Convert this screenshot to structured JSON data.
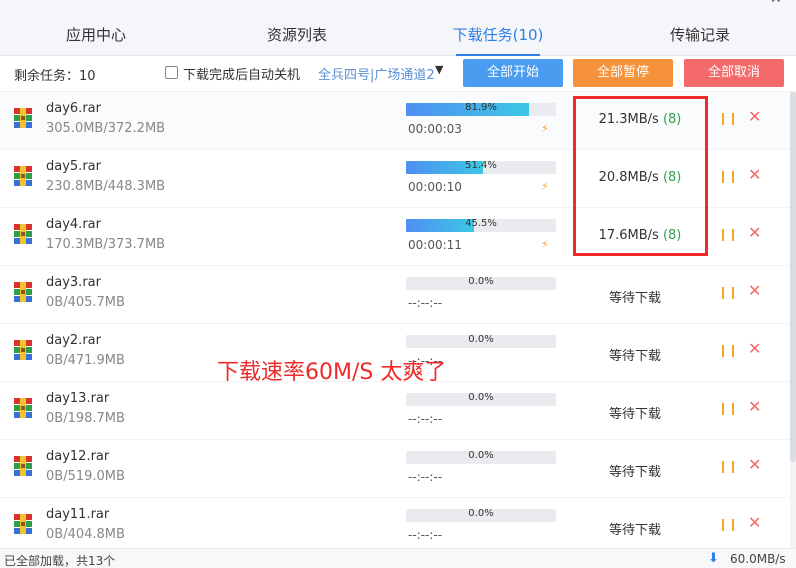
{
  "tabs": [
    {
      "label": "应用中心",
      "active": false
    },
    {
      "label": "资源列表",
      "active": false
    },
    {
      "label": "下载任务(10)",
      "active": true
    },
    {
      "label": "传输记录",
      "active": false
    }
  ],
  "toolbar": {
    "remaining": "剩余任务：10",
    "auto_shutdown_label": "下载完成后自动关机",
    "auto_shutdown_checked": false,
    "channel": "全兵四号|广场通道2",
    "start_all": "全部开始",
    "pause_all": "全部暂停",
    "cancel_all": "全部取消"
  },
  "tasks": [
    {
      "name": "day6.rar",
      "size": "305.0MB/372.2MB",
      "progress": 81.9,
      "progress_label": "81.9%",
      "elapsed": "00:00:03",
      "speed": "21.3MB/s",
      "connections": "(8)",
      "status": "downloading"
    },
    {
      "name": "day5.rar",
      "size": "230.8MB/448.3MB",
      "progress": 51.4,
      "progress_label": "51.4%",
      "elapsed": "00:00:10",
      "speed": "20.8MB/s",
      "connections": "(8)",
      "status": "downloading"
    },
    {
      "name": "day4.rar",
      "size": "170.3MB/373.7MB",
      "progress": 45.5,
      "progress_label": "45.5%",
      "elapsed": "00:00:11",
      "speed": "17.6MB/s",
      "connections": "(8)",
      "status": "downloading"
    },
    {
      "name": "day3.rar",
      "size": "0B/405.7MB",
      "progress": 0,
      "progress_label": "0.0%",
      "elapsed": "--:--:--",
      "wait_label": "等待下载",
      "status": "waiting"
    },
    {
      "name": "day2.rar",
      "size": "0B/471.9MB",
      "progress": 0,
      "progress_label": "0.0%",
      "elapsed": "--:--:--",
      "wait_label": "等待下载",
      "status": "waiting"
    },
    {
      "name": "day13.rar",
      "size": "0B/198.7MB",
      "progress": 0,
      "progress_label": "0.0%",
      "elapsed": "--:--:--",
      "wait_label": "等待下载",
      "status": "waiting"
    },
    {
      "name": "day12.rar",
      "size": "0B/519.0MB",
      "progress": 0,
      "progress_label": "0.0%",
      "elapsed": "--:--:--",
      "wait_label": "等待下载",
      "status": "waiting"
    },
    {
      "name": "day11.rar",
      "size": "0B/404.8MB",
      "progress": 0,
      "progress_label": "0.0%",
      "elapsed": "--:--:--",
      "wait_label": "等待下载",
      "status": "waiting"
    }
  ],
  "overlay_caption": "下载速率60M/S 太爽了",
  "statusbar": {
    "loaded_text": "已全部加载，共13个",
    "total_speed": "60.0MB/s"
  },
  "colors": {
    "accent": "#2f7fe8",
    "start_button": "#4a9cf0",
    "pause_button": "#f5923a",
    "cancel_button": "#f46a6a",
    "highlight": "#ee2a2a",
    "connections": "#2ea44f"
  },
  "icons": {
    "file": "winrar-archive-icon",
    "pause": "pause-icon",
    "cancel": "close-icon",
    "boost": "lightning-icon",
    "total_speed": "download-arrow-icon",
    "channel": "dropdown-caret-icon"
  }
}
